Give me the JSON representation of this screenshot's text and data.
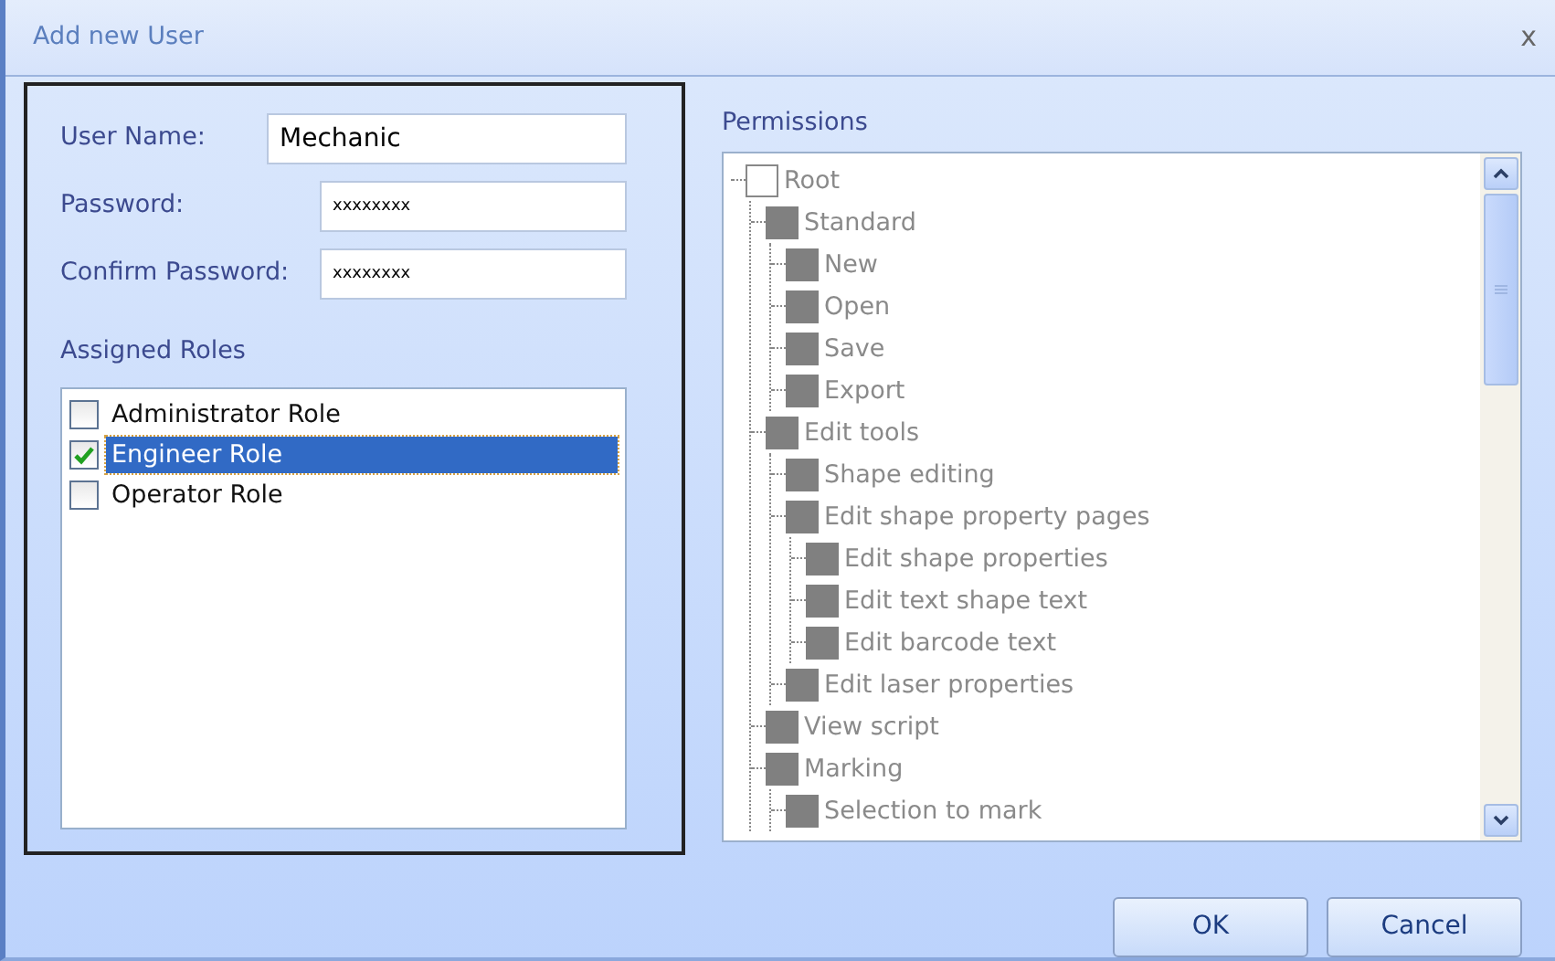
{
  "window": {
    "title": "Add new User",
    "close": "x"
  },
  "fields": [
    {
      "label": "User Name:",
      "value": "Mechanic",
      "kind": "text"
    },
    {
      "label": "Password:",
      "value": "xxxxxxxx",
      "kind": "password"
    },
    {
      "label": "Confirm Password:",
      "value": "xxxxxxxx",
      "kind": "password"
    }
  ],
  "roles": {
    "title": "Assigned Roles",
    "items": [
      {
        "label": "Administrator Role",
        "checked": false,
        "selected": false
      },
      {
        "label": "Engineer Role",
        "checked": true,
        "selected": true
      },
      {
        "label": "Operator Role",
        "checked": false,
        "selected": false
      }
    ]
  },
  "permissions": {
    "title": "Permissions",
    "tree": [
      {
        "label": "Root",
        "checked": false,
        "children": [
          {
            "label": "Standard",
            "checked": true,
            "children": [
              {
                "label": "New",
                "checked": true
              },
              {
                "label": "Open",
                "checked": true
              },
              {
                "label": "Save",
                "checked": true
              },
              {
                "label": "Export",
                "checked": true
              }
            ]
          },
          {
            "label": "Edit tools",
            "checked": true,
            "children": [
              {
                "label": "Shape editing",
                "checked": true
              },
              {
                "label": "Edit shape property pages",
                "checked": true,
                "children": [
                  {
                    "label": "Edit shape properties",
                    "checked": true
                  },
                  {
                    "label": "Edit text shape text",
                    "checked": true
                  },
                  {
                    "label": "Edit barcode text",
                    "checked": true
                  }
                ]
              },
              {
                "label": "Edit laser properties",
                "checked": true
              }
            ]
          },
          {
            "label": "View script",
            "checked": true
          },
          {
            "label": "Marking",
            "checked": true,
            "children": [
              {
                "label": "Selection to mark",
                "checked": true
              }
            ]
          }
        ]
      }
    ]
  },
  "buttons": [
    "OK",
    "Cancel"
  ]
}
